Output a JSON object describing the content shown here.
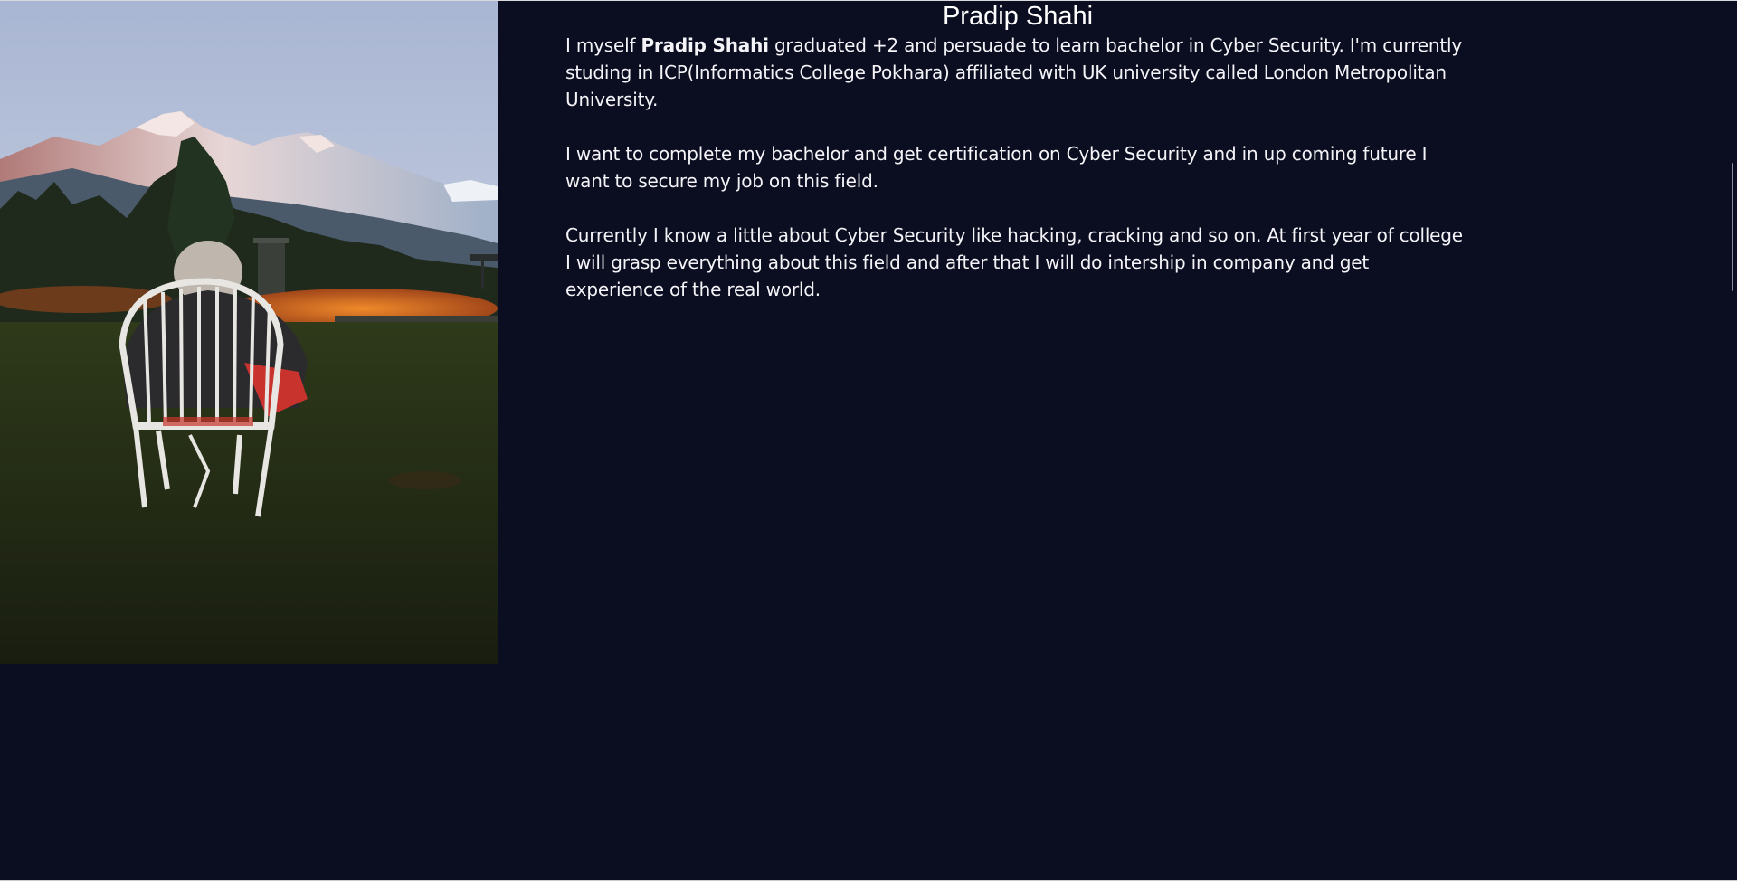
{
  "profile": {
    "name": "Pradip Shahi",
    "photo_alt": "",
    "intro": {
      "before": "I myself ",
      "bold_name": "Pradip Shahi",
      "after": " graduated +2 and persuade to learn bachelor in Cyber Security. I'm currently studing in ICP(Informatics College Pokhara) affiliated with UK university called London Metropolitan University."
    },
    "goals": "I want to complete my bachelor and get certification on Cyber Security and in up coming future I want to secure my job on this field.",
    "current": "Currently I know a little about Cyber Security like hacking, cracking and so on. At first year of college I will grasp everything about this field and after that I will do intership in company and get experience of the real world."
  },
  "colors": {
    "background": "#0b0d20",
    "text": "#ffffff"
  }
}
